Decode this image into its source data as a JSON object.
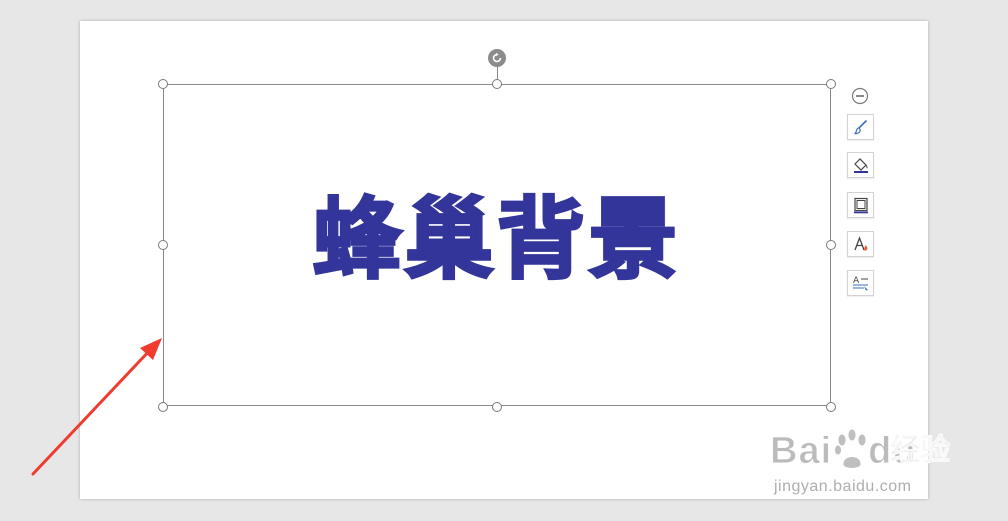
{
  "document": {
    "wordart_text": "蜂巢背景",
    "wordart_color": "#33359a"
  },
  "selection": {
    "border_color": "#8a8a8a",
    "handles": [
      "top-left",
      "top-center",
      "top-right",
      "middle-left",
      "middle-right",
      "bottom-left",
      "bottom-center",
      "bottom-right"
    ]
  },
  "float_toolbar": {
    "collapse_icon": "minus-circle-icon",
    "buttons": [
      {
        "name": "style-brush-button",
        "icon": "paintbrush-icon"
      },
      {
        "name": "fill-button",
        "icon": "paint-bucket-icon"
      },
      {
        "name": "outline-button",
        "icon": "shape-outline-icon"
      },
      {
        "name": "text-fill-button",
        "icon": "font-color-icon"
      },
      {
        "name": "text-wrap-button",
        "icon": "text-wrap-icon"
      }
    ]
  },
  "annotation": {
    "arrow_color": "#f03c2f"
  },
  "watermark": {
    "logo_left": "Bai",
    "logo_right": "du",
    "product": "经验",
    "url": "jingyan.baidu.com"
  }
}
